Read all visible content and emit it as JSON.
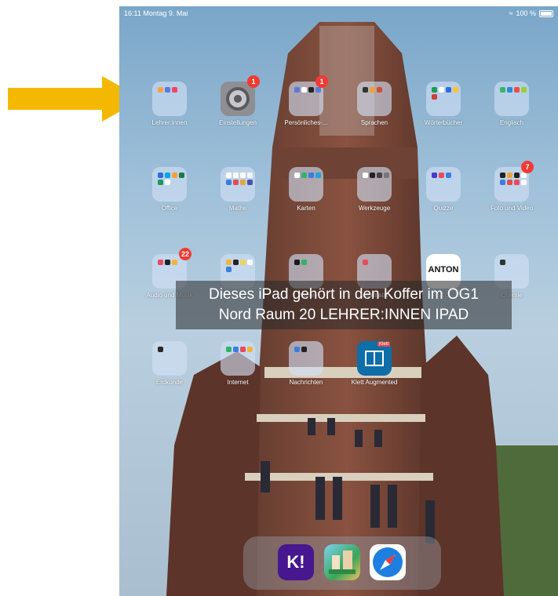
{
  "status": {
    "time_date": "16:11  Montag 9. Mai",
    "battery": "100 %"
  },
  "apps": [
    {
      "label": "Lehrer:innen",
      "kind": "folder",
      "badge": "",
      "minis": [
        "#ff9f43",
        "#5a7bd8",
        "#e84a5f"
      ]
    },
    {
      "label": "Einstellungen",
      "kind": "settings",
      "badge": "1"
    },
    {
      "label": "Persönliches-...",
      "kind": "folder",
      "badge": "1",
      "minis": [
        "#5a7bd8",
        "#ffffff",
        "#222",
        "#5a7bd8"
      ]
    },
    {
      "label": "Sprachen",
      "kind": "folder",
      "badge": "",
      "minis": [
        "#333",
        "#e8a53a",
        "#d14d3a"
      ]
    },
    {
      "label": "Wörterbücher",
      "kind": "folder",
      "badge": "",
      "minis": [
        "#1a9c5b",
        "#ffffff",
        "#2b6ee0",
        "#ffc233",
        "#d43b3b"
      ]
    },
    {
      "label": "Englisch",
      "kind": "folder",
      "badge": "",
      "minis": [
        "#3cb371",
        "#2f8bd6",
        "#e94f4f",
        "#9acd32"
      ]
    },
    {
      "label": "Office",
      "kind": "folder",
      "badge": "",
      "minis": [
        "#2b6ee0",
        "#0aa5e6",
        "#f4a13b",
        "#1f7a43",
        "#1d9a5b",
        "#ffffff"
      ]
    },
    {
      "label": "Mathe",
      "kind": "folder",
      "badge": "",
      "minis": [
        "#fff",
        "#fff",
        "#fff",
        "#f3f3f3",
        "#3b7de0",
        "#e34c4c",
        "#e8a53a",
        "#4455aa"
      ]
    },
    {
      "label": "Karten",
      "kind": "folder",
      "badge": "",
      "minis": [
        "#ffffff",
        "#2fb36b",
        "#3b7de0",
        "#20a5e0"
      ]
    },
    {
      "label": "Werkzeuge",
      "kind": "folder",
      "badge": "",
      "minis": [
        "#ffffff",
        "#222",
        "#444",
        "#777"
      ]
    },
    {
      "label": "Quizze",
      "kind": "folder",
      "badge": "",
      "minis": [
        "#4a3cc7",
        "#e84a5f",
        "#3b7de0"
      ]
    },
    {
      "label": "Foto und Video",
      "kind": "folder",
      "badge": "7",
      "minis": [
        "#222",
        "#e8a53a",
        "#222",
        "#ffffff",
        "#3b7de0",
        "#e34c4c",
        "#e84a5f",
        "#ffffff"
      ]
    },
    {
      "label": "Audio und Musik",
      "kind": "folder",
      "badge": "22",
      "minis": [
        "#e84a5f",
        "#222",
        "#f0b63a"
      ]
    },
    {
      "label": "Geschichte",
      "kind": "folder",
      "badge": "",
      "minis": [
        "#f0b63a",
        "#222",
        "#e8d55a",
        "#ffffff",
        "#3b7de0"
      ]
    },
    {
      "label": "Werte",
      "kind": "folder",
      "badge": "",
      "minis": [
        "#1a1a1a",
        "#2fb36b"
      ]
    },
    {
      "label": "Informatik",
      "kind": "folder",
      "badge": "",
      "minis": [
        "#e84a5f"
      ]
    },
    {
      "label": "ANTON",
      "kind": "anton",
      "badge": "",
      "icon_text": "ANTON"
    },
    {
      "label": "Chemie",
      "kind": "folder",
      "badge": "",
      "minis": [
        "#333"
      ]
    },
    {
      "label": "Erdkunde",
      "kind": "folder",
      "badge": "",
      "minis": [
        "#2a2a2a"
      ]
    },
    {
      "label": "Internet",
      "kind": "folder",
      "badge": "",
      "minis": [
        "#2fb36b",
        "#3b7de0",
        "#e84a5f",
        "#f0b63a"
      ]
    },
    {
      "label": "Nachrichten",
      "kind": "folder",
      "badge": "",
      "minis": [
        "#3b7de0",
        "#222"
      ]
    },
    {
      "label": "Klett Augmented",
      "kind": "klett",
      "badge": "",
      "icon_text": "Klett"
    }
  ],
  "overlay": {
    "line1": "Dieses iPad gehört in den Koffer im OG1",
    "line2": "Nord Raum 20 LEHRER:INNEN IPAD"
  },
  "dock": [
    "Kahoot!",
    "Stadtspiel",
    "Safari"
  ],
  "dock_icon_text": {
    "kahoot": "K!"
  },
  "colors": {
    "arrow": "#f5b800",
    "badge": "#f23a32",
    "accent_blue": "#1d7fe0"
  }
}
